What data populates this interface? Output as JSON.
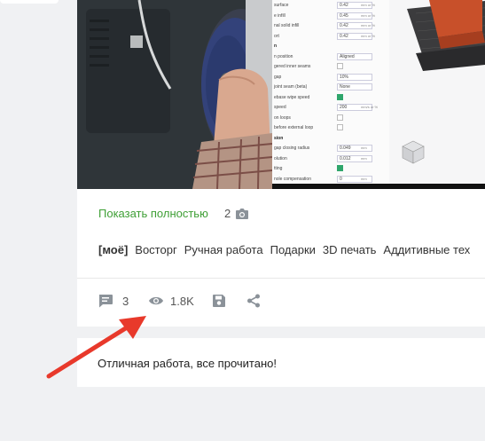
{
  "post": {
    "show_more_label": "Показать полностью",
    "photo_count": "2",
    "tags": [
      "[моё]",
      "Восторг",
      "Ручная работа",
      "Подарки",
      "3D печать",
      "Аддитивные тех"
    ],
    "actions": {
      "comments_count": "3",
      "views_count": "1.8K"
    }
  },
  "screenshot_settings": [
    {
      "label": "surface",
      "value": "0.42",
      "unit": "mm or %"
    },
    {
      "label": "e infill",
      "value": "0.45",
      "unit": "mm or %"
    },
    {
      "label": "nal solid infill",
      "value": "0.42",
      "unit": "mm or %"
    },
    {
      "label": "ort",
      "value": "0.42",
      "unit": "mm or %"
    },
    {
      "label": "n",
      "head": true
    },
    {
      "label": "n position",
      "value": "Aligned"
    },
    {
      "label": "gered inner seams",
      "check": false
    },
    {
      "label": "gap",
      "value": "10%"
    },
    {
      "label": "joint seam (beta)",
      "value": "None"
    },
    {
      "label": "ebase wipe speed",
      "check": true
    },
    {
      "label": "speed",
      "value": "200",
      "unit": "mm/s or %"
    },
    {
      "label": "on loops",
      "check": false
    },
    {
      "label": "before external loop",
      "check": false
    },
    {
      "label": "sion",
      "head": true
    },
    {
      "label": "gap closing radius",
      "value": "0.049",
      "unit": "mm"
    },
    {
      "label": "olution",
      "value": "0.012",
      "unit": "mm"
    },
    {
      "label": "tting",
      "check": true
    },
    {
      "label": "nole compensation",
      "value": "0",
      "unit": "mm"
    }
  ],
  "comment": {
    "text": "Отличная работа, все прочитано!"
  },
  "icons": {
    "camera": "camera-icon",
    "comments": "comment-icon",
    "views": "eye-icon",
    "save": "save-icon",
    "share": "share-icon"
  },
  "colors": {
    "accent_green": "#3e9f35",
    "arrow_red": "#e8392b",
    "icon_grey": "#8b9299"
  }
}
